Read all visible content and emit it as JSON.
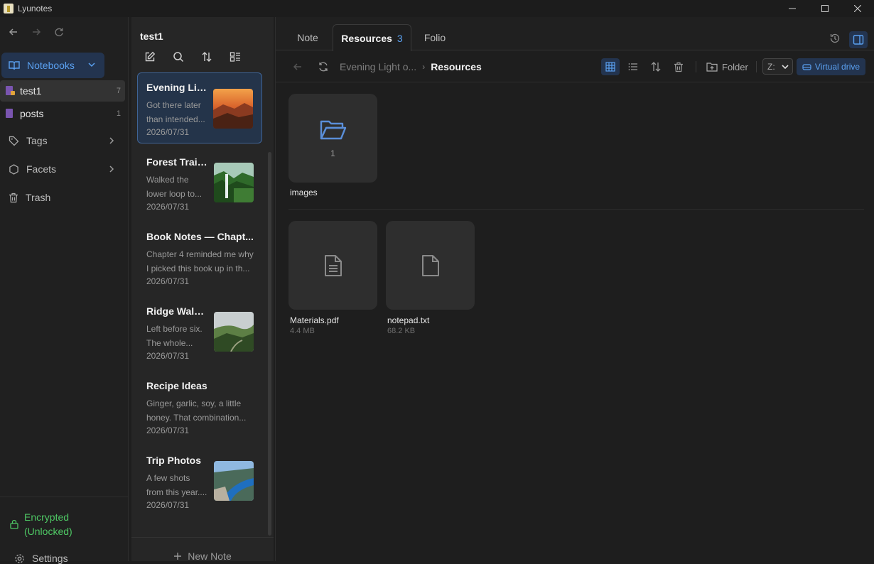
{
  "window": {
    "title": "Lyunotes"
  },
  "sidebar": {
    "notebooks_label": "Notebooks",
    "notebooks": [
      {
        "name": "test1",
        "count": "7"
      },
      {
        "name": "posts",
        "count": "1"
      }
    ],
    "links": [
      {
        "label": "Tags"
      },
      {
        "label": "Facets"
      },
      {
        "label": "Trash"
      }
    ],
    "encryption_status": "Encrypted",
    "encryption_state": "(Unlocked)",
    "settings_label": "Settings"
  },
  "notelist": {
    "title": "test1",
    "notes": [
      {
        "title": "Evening Lig...",
        "preview": "Got there later than intended...",
        "date": "2026/07/31",
        "thumb": "sunset-canyon"
      },
      {
        "title": "Forest Trail...",
        "preview": "Walked the lower loop to...",
        "date": "2026/07/31",
        "thumb": "waterfall"
      },
      {
        "title": "Book Notes — Chapt...",
        "preview": "Chapter 4 reminded me why I picked this book up in th...",
        "date": "2026/07/31",
        "thumb": ""
      },
      {
        "title": "Ridge Walk...",
        "preview": "Left before six. The whole...",
        "date": "2026/07/31",
        "thumb": "green-ridge"
      },
      {
        "title": "Recipe Ideas",
        "preview": "Ginger, garlic, soy, a little honey. That combination...",
        "date": "2026/07/31",
        "thumb": ""
      },
      {
        "title": "Trip Photos",
        "preview": "A few shots from this year....",
        "date": "2026/07/31",
        "thumb": "fjord"
      }
    ],
    "new_note_label": "New Note"
  },
  "main": {
    "tabs": [
      {
        "label": "Note",
        "badge": ""
      },
      {
        "label": "Resources",
        "badge": "3"
      },
      {
        "label": "Folio",
        "badge": ""
      }
    ],
    "breadcrumb": {
      "parent": "Evening Light o...",
      "current": "Resources"
    },
    "folder_btn_label": "Folder",
    "sort_select_value": "Z:",
    "virtual_drive_label": "Virtual drive",
    "folders": [
      {
        "name": "images",
        "count": "1"
      }
    ],
    "files": [
      {
        "name": "Materials.pdf",
        "size": "4.4 MB",
        "icon": "document-lines-icon"
      },
      {
        "name": "notepad.txt",
        "size": "68.2 KB",
        "icon": "file-blank-icon"
      }
    ]
  },
  "colors": {
    "accent": "#5aa0f0",
    "accent_bg": "#23344f",
    "encrypted_green": "#4ec764"
  }
}
